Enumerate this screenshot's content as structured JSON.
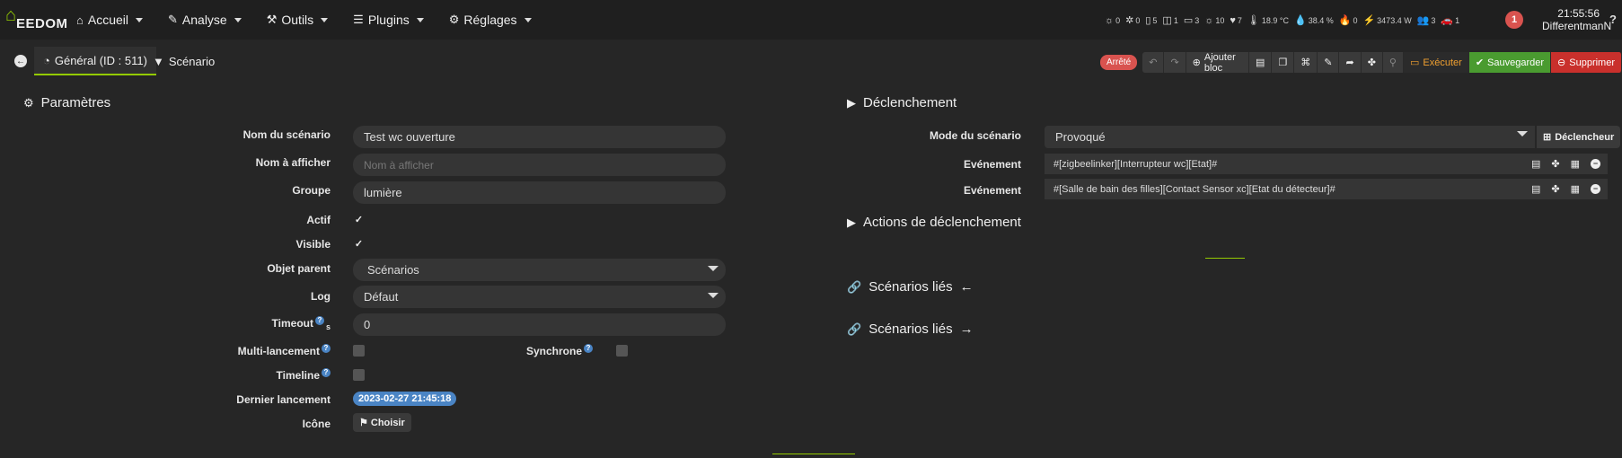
{
  "brand": {
    "name": "EEDOM"
  },
  "menu": [
    {
      "icon": "⌂",
      "label": "Accueil"
    },
    {
      "icon": "✎",
      "label": "Analyse"
    },
    {
      "icon": "⚒",
      "label": "Outils"
    },
    {
      "icon": "☰",
      "label": "Plugins"
    },
    {
      "icon": "⚙",
      "label": "Réglages"
    }
  ],
  "status_bar": [
    {
      "icon": "☼",
      "value": "0"
    },
    {
      "icon": "✲",
      "value": "0"
    },
    {
      "icon": "▯",
      "value": "5"
    },
    {
      "icon": "◫",
      "value": "1"
    },
    {
      "icon": "▭",
      "value": "3"
    },
    {
      "icon": "☼",
      "value": "10"
    },
    {
      "icon": "♥",
      "value": "7"
    },
    {
      "icon": "🌡",
      "value": "18.9 °C"
    },
    {
      "icon": "💧",
      "value": "38.4 %"
    },
    {
      "icon": "🔥",
      "value": "0"
    },
    {
      "icon": "⚡",
      "value": "3473.4 W"
    },
    {
      "icon": "👥",
      "value": "3"
    },
    {
      "icon": "🚗",
      "value": "1"
    }
  ],
  "notifications": {
    "count": "1"
  },
  "clock": {
    "time": "21:55:56",
    "user": "DifferentmanN"
  },
  "tabs": [
    {
      "label": "Général (ID : 511)",
      "active": true
    },
    {
      "label": "Scénario",
      "active": false
    }
  ],
  "toolbar": {
    "state": "Arrêté",
    "add_block": "Ajouter bloc",
    "execute": "Exécuter",
    "save": "Sauvegarder",
    "delete": "Supprimer"
  },
  "params": {
    "title": "Paramètres",
    "name_label": "Nom du scénario",
    "name_value": "Test wc ouverture",
    "display_label": "Nom à afficher",
    "display_placeholder": "Nom à afficher",
    "group_label": "Groupe",
    "group_value": "lumière",
    "active_label": "Actif",
    "active_checked": true,
    "visible_label": "Visible",
    "visible_checked": true,
    "parent_label": "Objet parent",
    "parent_value": "Scénarios",
    "log_label": "Log",
    "log_value": "Défaut",
    "timeout_label": "Timeout",
    "timeout_unit": "s",
    "timeout_value": "0",
    "multi_label": "Multi-lancement",
    "sync_label": "Synchrone",
    "timeline_label": "Timeline",
    "last_run_label": "Dernier lancement",
    "last_run_value": "2023-02-27 21:45:18",
    "icon_label": "Icône",
    "choose_label": "Choisir"
  },
  "trigger": {
    "title": "Déclenchement",
    "mode_label": "Mode du scénario",
    "mode_value": "Provoqué",
    "add_trigger": "Déclencheur",
    "events": [
      {
        "label": "Evénement",
        "value": "#[zigbeelinker][Interrupteur wc][Etat]#"
      },
      {
        "label": "Evénement",
        "value": "#[Salle de bain des filles][Contact Sensor xc][Etat du détecteur]#"
      }
    ],
    "actions_title": "Actions de déclenchement",
    "linked_in_title": "Scénarios liés",
    "linked_out_title": "Scénarios liés"
  }
}
